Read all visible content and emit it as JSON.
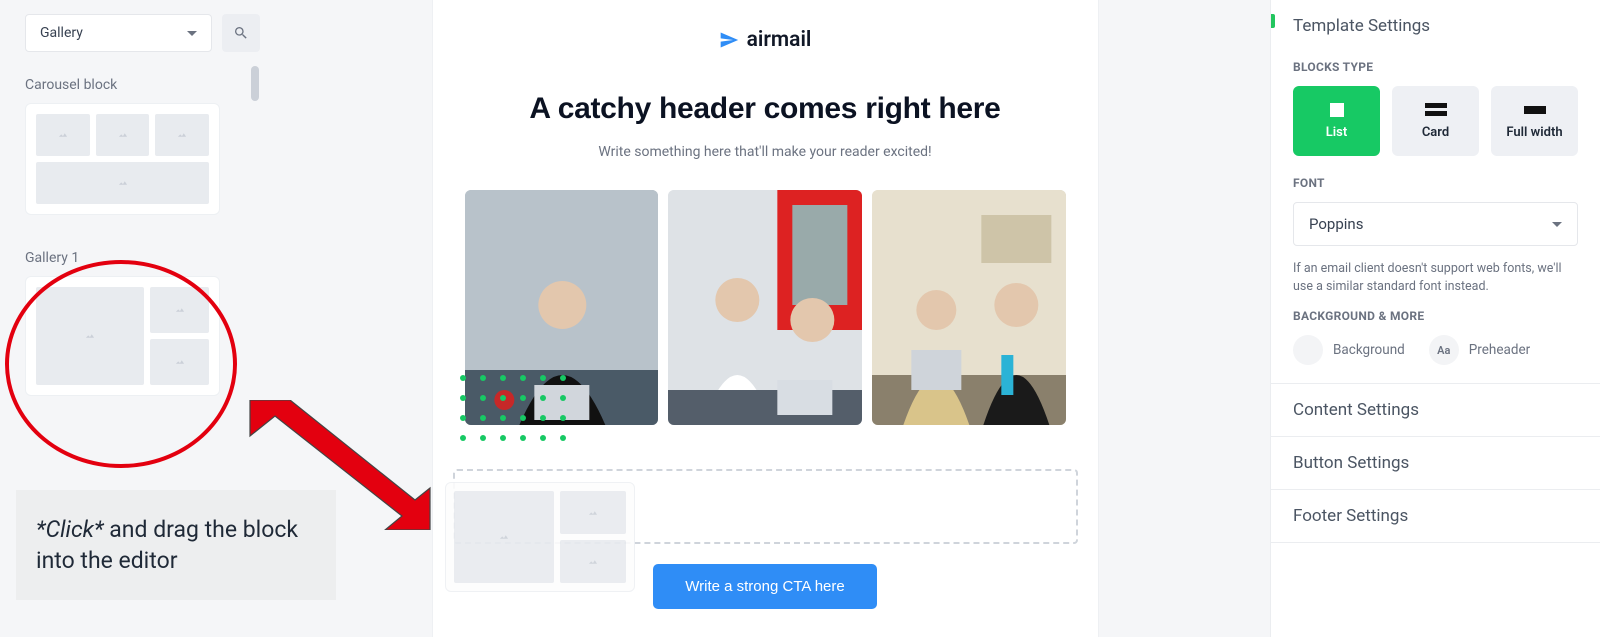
{
  "left": {
    "filter_value": "Gallery",
    "blocks": {
      "carousel_title": "Carousel block",
      "gallery_title": "Gallery 1"
    },
    "instruction_emph": "*Click*",
    "instruction_rest": " and drag the block into the editor"
  },
  "canvas": {
    "brand": "airmail",
    "hero_title": "A catchy header comes right here",
    "hero_sub": "Write something here that'll make your reader excited!",
    "cta_label": "Write a strong CTA here"
  },
  "right": {
    "sections": {
      "template": "Template Settings",
      "content": "Content Settings",
      "button": "Button Settings",
      "footer": "Footer Settings"
    },
    "blocks_type_label": "BLOCKS TYPE",
    "block_types": {
      "list": "List",
      "card": "Card",
      "full": "Full width"
    },
    "font_label": "FONT",
    "font_value": "Poppins",
    "font_note": "If an email client doesn't support web fonts, we'll use a similar standard font instead.",
    "bg_section_label": "BACKGROUND & MORE",
    "bg_label": "Background",
    "preheader_label": "Preheader",
    "preheader_icon_text": "Aa"
  }
}
